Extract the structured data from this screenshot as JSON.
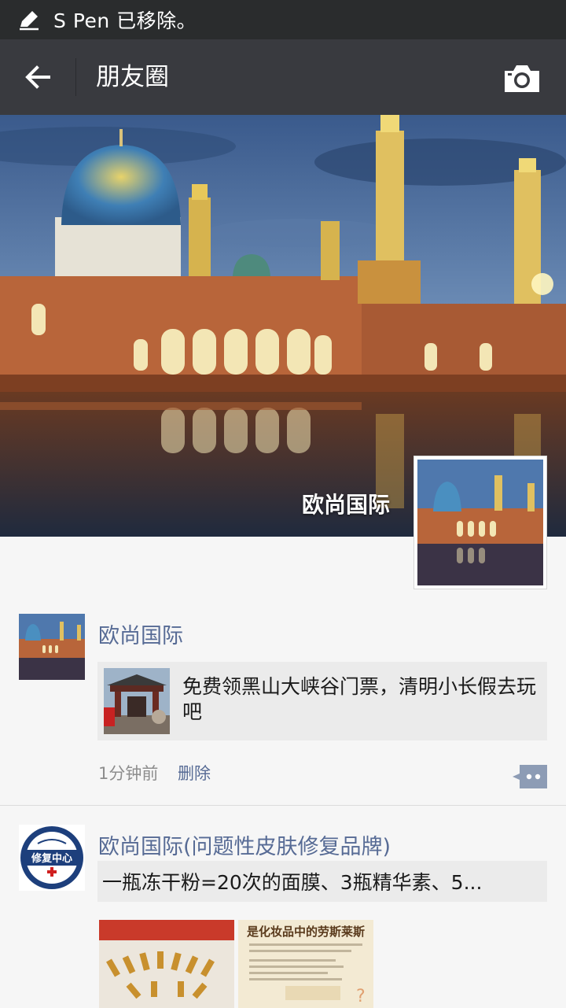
{
  "status_bar": {
    "message": "S Pen 已移除。",
    "icon": "pen-icon"
  },
  "title_bar": {
    "back_icon": "back-arrow-icon",
    "title": "朋友圈",
    "camera_icon": "camera-icon"
  },
  "cover": {
    "username": "欧尚国际"
  },
  "posts": [
    {
      "username": "欧尚国际",
      "shared_link": {
        "text": "免费领黑山大峡谷门票，清明小长假去玩吧"
      },
      "time": "1分钟前",
      "delete_label": "删除",
      "comment_icon": "comment-icon"
    },
    {
      "username": "欧尚国际(问题性皮肤修复品牌)",
      "caption": "一瓶冻干粉=20次的面膜、3瓶精华素、5...",
      "logo_text": "修复中心",
      "images": [
        {
          "text": ""
        },
        {
          "text": "是化妆品中的劳斯莱斯"
        }
      ]
    }
  ],
  "colors": {
    "status_bg": "#2a2c2d",
    "titlebar_bg": "#393a3f",
    "link_blue": "#576b95",
    "feed_bg": "#f6f6f6"
  }
}
